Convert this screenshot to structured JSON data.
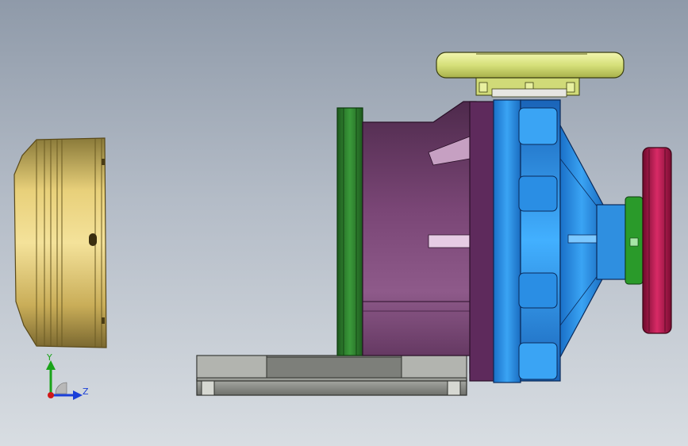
{
  "viewport": {
    "background_top": "#8f9aa9",
    "background_bottom": "#d8dde2"
  },
  "triad": {
    "y_label": "Y",
    "z_label": "Z",
    "y_color": "#1aa31a",
    "z_color": "#1a3fd8",
    "x_color": "#d01818"
  },
  "parts": {
    "cover_color": "#e2c86a",
    "base_color": "#8a8c88",
    "flange_color": "#2a7a2a",
    "bracket_color": "#7a3f76",
    "casing_color": "#2f8fe0",
    "nozzle_flange_color": "#d6e07a",
    "coupling_color": "#b0184e"
  }
}
